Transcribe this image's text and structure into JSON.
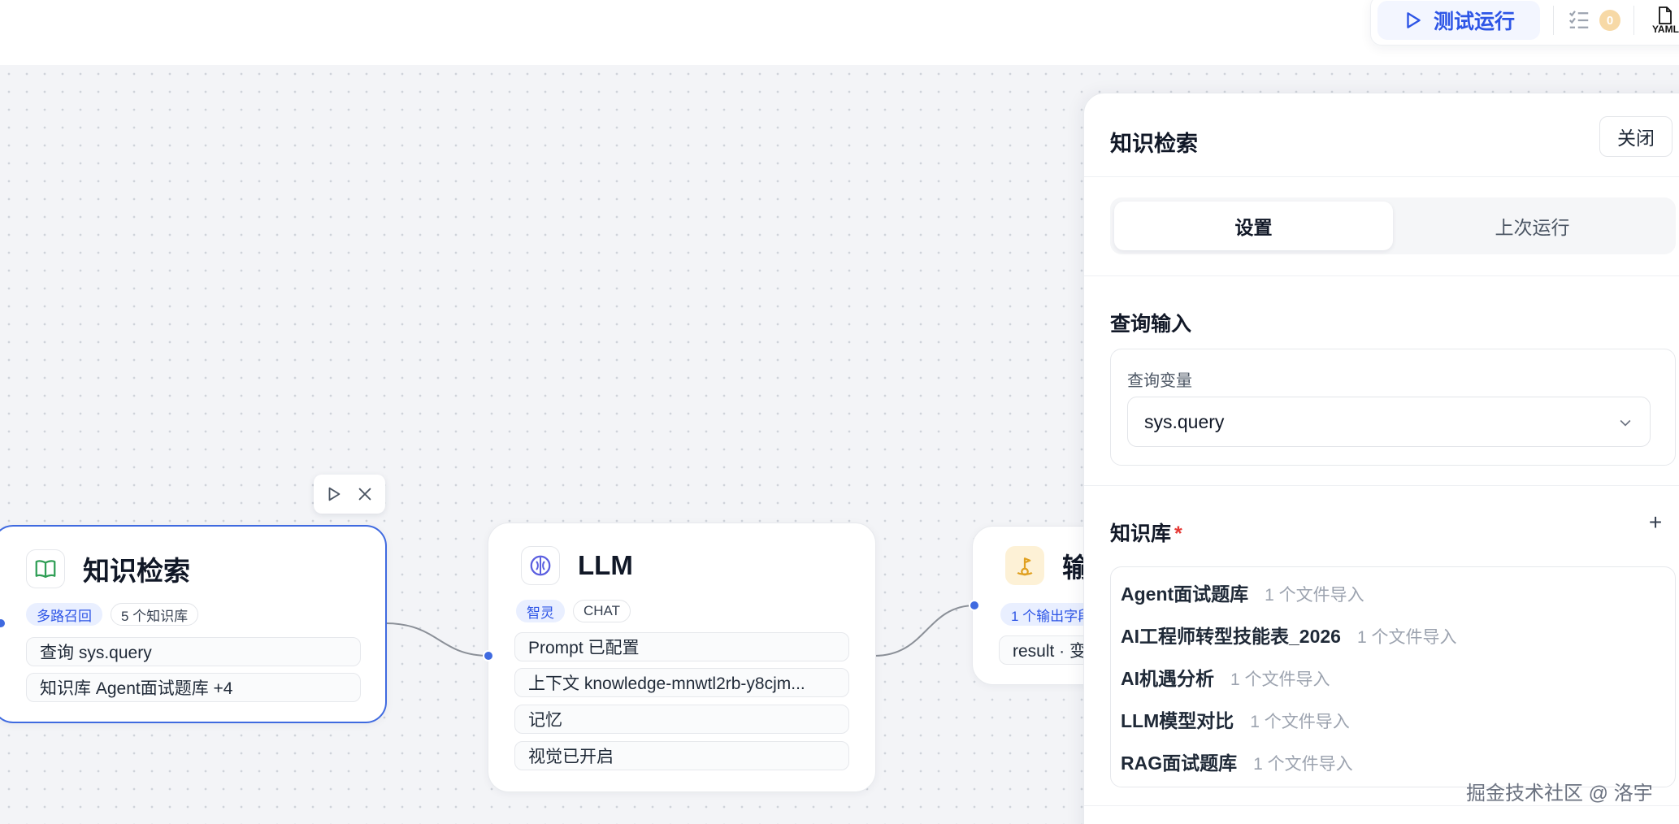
{
  "toolbar": {
    "run_label": "测试运行",
    "checklist_count": "0",
    "yaml_label": "YAML"
  },
  "nodes": {
    "knowledge": {
      "title": "知识检索",
      "tags": [
        "多路召回",
        "5 个知识库"
      ],
      "rows": [
        "查询 sys.query",
        "知识库 Agent面试题库 +4"
      ]
    },
    "llm": {
      "title": "LLM",
      "tags": [
        "智灵",
        "CHAT"
      ],
      "rows": [
        "Prompt 已配置",
        "上下文 knowledge-mnwtl2rb-y8cjm...",
        "记忆",
        "视觉已开启"
      ]
    },
    "output": {
      "title": "输",
      "tags": [
        "1 个输出字段"
      ],
      "rows": [
        "result · 变"
      ]
    }
  },
  "panel": {
    "title": "知识检索",
    "close_label": "关闭",
    "tabs": [
      "设置",
      "上次运行"
    ],
    "query_section": "查询输入",
    "query_label": "查询变量",
    "query_value": "sys.query",
    "kb_section": "知识库",
    "kb_required": "*",
    "add_label": "+",
    "knowledge_bases": [
      {
        "name": "Agent面试题库",
        "meta": "1 个文件导入"
      },
      {
        "name": "AI工程师转型技能表_2026",
        "meta": "1 个文件导入"
      },
      {
        "name": "AI机遇分析",
        "meta": "1 个文件导入"
      },
      {
        "name": "LLM模型对比",
        "meta": "1 个文件导入"
      },
      {
        "name": "RAG面试题库",
        "meta": "1 个文件导入"
      }
    ]
  },
  "watermark": "掘金技术社区 @ 洛宇",
  "colors": {
    "accent": "#3f6ae0",
    "run_text": "#2d55e6",
    "canvas_bg": "#f3f4f7",
    "badge": "#f7d9a6",
    "required": "#e53935"
  }
}
